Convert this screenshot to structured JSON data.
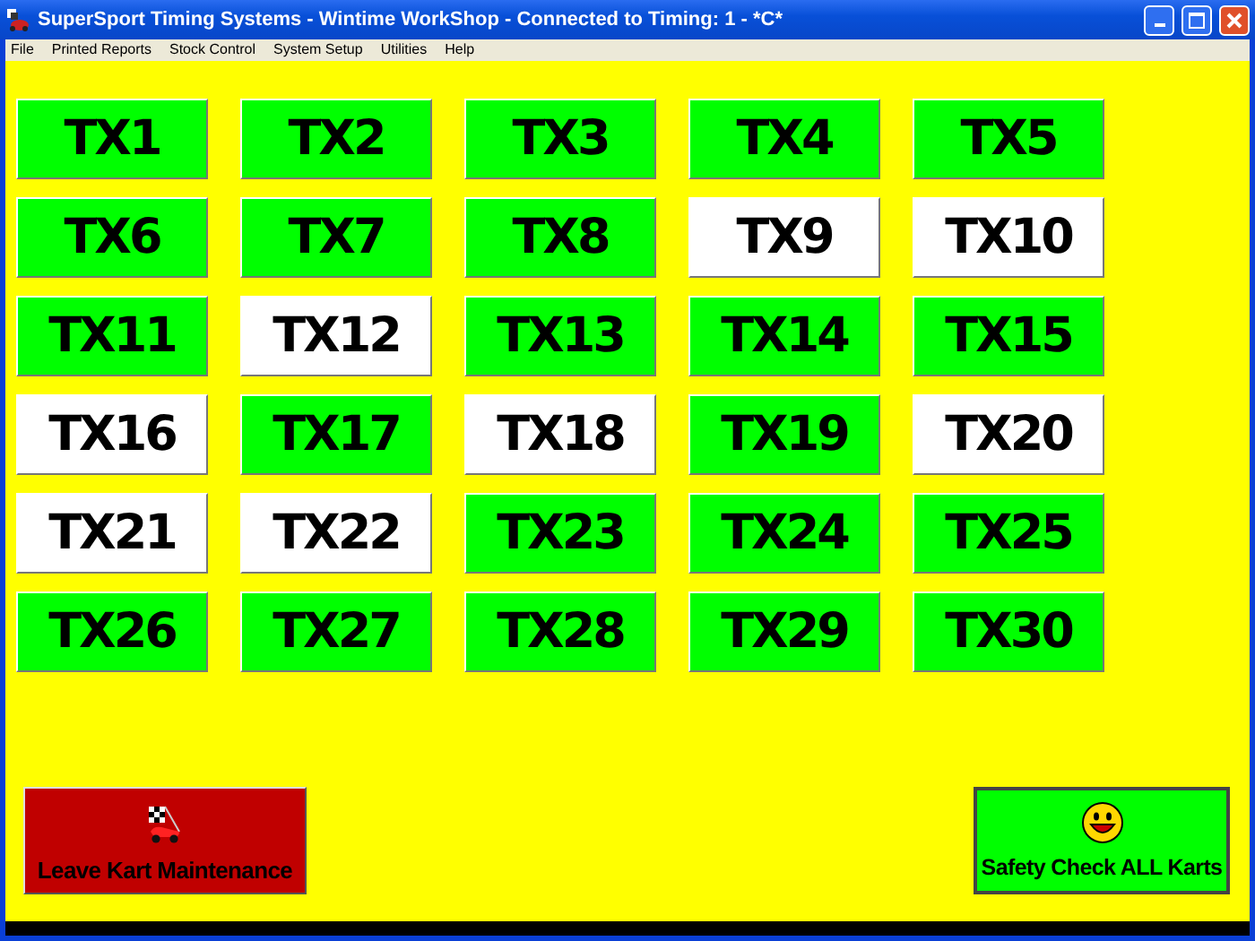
{
  "window": {
    "title": "SuperSport Timing Systems - Wintime WorkShop - Connected to Timing: 1 - *C*"
  },
  "menu": [
    "File",
    "Printed Reports",
    "Stock Control",
    "System Setup",
    "Utilities",
    "Help"
  ],
  "karts": [
    {
      "label": "TX1",
      "checked": true
    },
    {
      "label": "TX2",
      "checked": true
    },
    {
      "label": "TX3",
      "checked": true
    },
    {
      "label": "TX4",
      "checked": true
    },
    {
      "label": "TX5",
      "checked": true
    },
    {
      "label": "TX6",
      "checked": true
    },
    {
      "label": "TX7",
      "checked": true
    },
    {
      "label": "TX8",
      "checked": true
    },
    {
      "label": "TX9",
      "checked": false
    },
    {
      "label": "TX10",
      "checked": false
    },
    {
      "label": "TX11",
      "checked": true
    },
    {
      "label": "TX12",
      "checked": false
    },
    {
      "label": "TX13",
      "checked": true
    },
    {
      "label": "TX14",
      "checked": true
    },
    {
      "label": "TX15",
      "checked": true
    },
    {
      "label": "TX16",
      "checked": false
    },
    {
      "label": "TX17",
      "checked": true
    },
    {
      "label": "TX18",
      "checked": false
    },
    {
      "label": "TX19",
      "checked": true
    },
    {
      "label": "TX20",
      "checked": false
    },
    {
      "label": "TX21",
      "checked": false
    },
    {
      "label": "TX22",
      "checked": false
    },
    {
      "label": "TX23",
      "checked": true
    },
    {
      "label": "TX24",
      "checked": true
    },
    {
      "label": "TX25",
      "checked": true
    },
    {
      "label": "TX26",
      "checked": true
    },
    {
      "label": "TX27",
      "checked": true
    },
    {
      "label": "TX28",
      "checked": true
    },
    {
      "label": "TX29",
      "checked": true
    },
    {
      "label": "TX30",
      "checked": true
    }
  ],
  "actions": [
    {
      "label": "Leave Kart Maintenance",
      "kind": "exit"
    },
    {
      "label": "Safety Check ALL Karts",
      "kind": "check"
    }
  ]
}
